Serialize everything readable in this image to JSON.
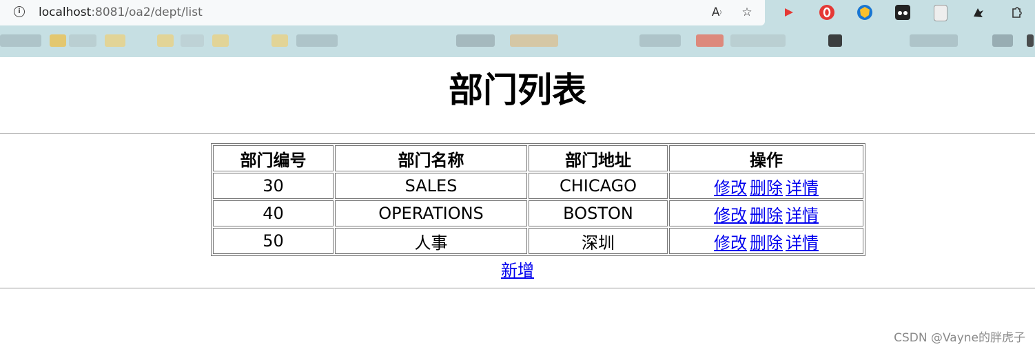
{
  "browser": {
    "url_host": "localhost",
    "url_rest": ":8081/oa2/dept/list",
    "icons": [
      "info-icon",
      "read-aloud-icon",
      "add-favorite-icon",
      "extension-icons",
      "extensions-icon"
    ]
  },
  "page": {
    "title": "部门列表",
    "table": {
      "headers": [
        "部门编号",
        "部门名称",
        "部门地址",
        "操作"
      ],
      "rows": [
        {
          "deptno": "30",
          "dname": "SALES",
          "loc": "CHICAGO"
        },
        {
          "deptno": "40",
          "dname": "OPERATIONS",
          "loc": "BOSTON"
        },
        {
          "deptno": "50",
          "dname": "人事",
          "loc": "深圳"
        }
      ],
      "actions": {
        "edit": "修改",
        "delete": "删除",
        "detail": "详情"
      }
    },
    "add_link": "新增"
  },
  "watermark": "CSDN @Vayne的胖虎子",
  "colors": {
    "link": "#0000ee",
    "chrome": "#c6dfe3",
    "addressbar": "#f7f9fa"
  }
}
